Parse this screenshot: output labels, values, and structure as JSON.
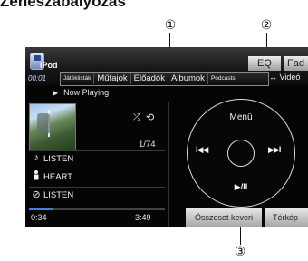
{
  "heading": "Zeneszabályozás",
  "callouts": {
    "c1": "①",
    "c2": "②",
    "c3": "③"
  },
  "top": {
    "source": "iPod",
    "time": "00:01",
    "tabs": [
      "Játéklisták",
      "Műfajok",
      "Előadók",
      "Albumok",
      "Podcasts"
    ],
    "eq": "EQ",
    "f": "Fad",
    "video": "↔ Videó"
  },
  "now_playing": "Now Playing",
  "track_count": "1/74",
  "rows": [
    {
      "icon": "music-note-icon",
      "glyph": "♪",
      "text": "LISTEN"
    },
    {
      "icon": "artist-icon",
      "glyph": "👤",
      "text": "HEART"
    },
    {
      "icon": "album-icon",
      "glyph": "⊘",
      "text": "LISTEN"
    }
  ],
  "progress": {
    "value": 0.18
  },
  "elapsed": "0:34",
  "remaining": "-3:49",
  "wheel": {
    "menu": "Menü",
    "prev": "I◀◀",
    "next": "▶▶I",
    "play": "▶/II"
  },
  "buttons": {
    "all": "Összeset keveri",
    "map": "Térkép"
  },
  "colors": {
    "accent": "#4c7be0",
    "background": "#050505"
  }
}
